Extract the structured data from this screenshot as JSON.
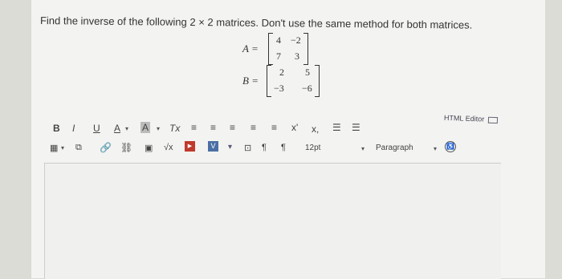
{
  "question": "Find the inverse of the following 2 × 2 matrices. Don't use the same method for both matrices.",
  "matrixA": {
    "label": "A =",
    "cells": [
      "4",
      "−2",
      "7",
      "3"
    ]
  },
  "matrixB": {
    "label": "B =",
    "cells": [
      "2",
      "5",
      "−3",
      "−6"
    ]
  },
  "toolbar": {
    "bold": "B",
    "italic": "I",
    "underline": "U",
    "font_color": "A",
    "highlight": "A",
    "clear_format": "Tx",
    "superscript": "x'",
    "subscript": "x,",
    "font_size": "12pt",
    "paragraph": "Paragraph",
    "html_editor": "HTML Editor"
  }
}
